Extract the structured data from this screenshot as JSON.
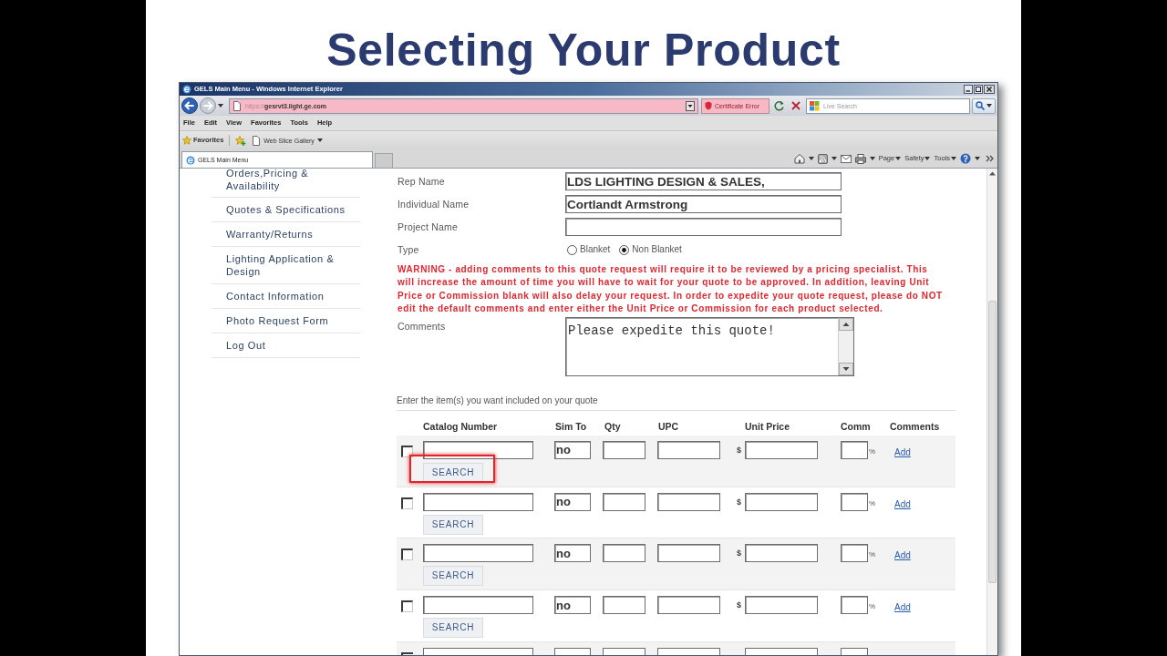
{
  "slide": {
    "title": "Selecting Your Product"
  },
  "window": {
    "title": "GELS Main Menu - Windows Internet Explorer"
  },
  "address_bar": {
    "scheme": "https://",
    "host": "gesrvt3.light.ge.com",
    "certificate_error": "Certificate Error",
    "search_placeholder": "Live Search"
  },
  "menu_bar": [
    "File",
    "Edit",
    "View",
    "Favorites",
    "Tools",
    "Help"
  ],
  "favorites_bar": {
    "favorites": "Favorites",
    "web_slice_gallery": "Web Slice Gallery"
  },
  "tabs": [
    {
      "label": "GELS Main Menu",
      "selected": true
    }
  ],
  "command_bar": [
    "Page",
    "Safety",
    "Tools"
  ],
  "sidebar": {
    "items": [
      "Orders,Pricing & Availability",
      "Quotes & Specifications",
      "Warranty/Returns",
      "Lighting Application & Design",
      "Contact Information",
      "Photo Request Form",
      "Log Out"
    ]
  },
  "form": {
    "fields": [
      {
        "label": "Rep Name",
        "value": "LDS LIGHTING DESIGN & SALES,"
      },
      {
        "label": "Individual Name",
        "value": "Cortlandt Armstrong"
      },
      {
        "label": "Project Name"
      }
    ],
    "type": {
      "label": "Type",
      "options": [
        {
          "label": "Blanket",
          "selected": false
        },
        {
          "label": "Non Blanket",
          "selected": true
        }
      ]
    },
    "warning": "WARNING - adding comments to this quote request will require it to be reviewed by a pricing specialist. This will increase the amount of time you will have to wait for your quote to be approved. In addition, leaving Unit Price or Commission blank will also delay your request. In order to expedite your quote request, please do NOT edit the default comments and enter either the Unit Price or Commission for each product selected.",
    "comments": {
      "label": "Comments",
      "value": "Please expedite this quote!"
    }
  },
  "items": {
    "intro": "Enter the item(s) you want included on your quote",
    "columns": [
      "Catalog Number",
      "Sim To",
      "Qty",
      "UPC",
      "Unit Price",
      "Comm",
      "Comments"
    ],
    "rows": [
      {
        "kind": "full",
        "checked": false,
        "sim_to": "no",
        "currency": "$",
        "percent": "%",
        "comments_link": "Add",
        "search_button": "SEARCH",
        "highlighted": true
      },
      {
        "kind": "full",
        "checked": false,
        "sim_to": "no",
        "currency": "$",
        "percent": "%",
        "comments_link": "Add",
        "search_button": "SEARCH",
        "highlighted": false
      },
      {
        "kind": "full",
        "checked": false,
        "sim_to": "no",
        "currency": "$",
        "percent": "%",
        "comments_link": "Add",
        "search_button": "SEARCH",
        "highlighted": false
      },
      {
        "kind": "full",
        "checked": false,
        "sim_to": "no",
        "currency": "$",
        "percent": "%",
        "comments_link": "Add",
        "search_button": "SEARCH",
        "highlighted": false
      },
      {
        "kind": "cut",
        "checked": false
      }
    ]
  }
}
